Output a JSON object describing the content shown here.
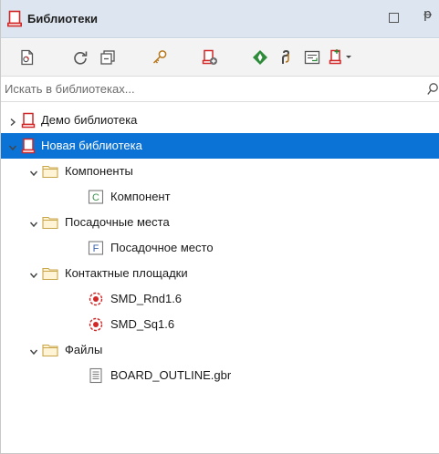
{
  "window": {
    "title": "Библиотеки"
  },
  "toolbar": {
    "buttons": [
      {
        "name": "open-library",
        "icon": "open-document-icon"
      },
      {
        "name": "refresh",
        "icon": "refresh-icon"
      },
      {
        "name": "collapse-all",
        "icon": "collapse-icon"
      },
      {
        "name": "key",
        "icon": "key-icon"
      },
      {
        "name": "add-library",
        "icon": "add-library-icon"
      },
      {
        "name": "navigate",
        "icon": "navigate-icon"
      },
      {
        "name": "link",
        "icon": "link-icon"
      },
      {
        "name": "properties",
        "icon": "properties-icon"
      },
      {
        "name": "library-menu",
        "icon": "library-dropdown-icon"
      }
    ]
  },
  "search": {
    "placeholder": "Искать в библиотеках..."
  },
  "tree": {
    "items": [
      {
        "label": "Демо библиотека",
        "level": 0,
        "expanded": false,
        "type": "library",
        "selected": false
      },
      {
        "label": "Новая библиотека",
        "level": 0,
        "expanded": true,
        "type": "library",
        "selected": true
      },
      {
        "label": "Компоненты",
        "level": 1,
        "expanded": true,
        "type": "folder",
        "selected": false
      },
      {
        "label": "Компонент",
        "level": 2,
        "type": "component",
        "badge": "C",
        "selected": false
      },
      {
        "label": "Посадочные места",
        "level": 1,
        "expanded": true,
        "type": "folder",
        "selected": false
      },
      {
        "label": "Посадочное место",
        "level": 2,
        "type": "footprint",
        "badge": "F",
        "selected": false
      },
      {
        "label": "Контактные площадки",
        "level": 1,
        "expanded": true,
        "type": "folder",
        "selected": false
      },
      {
        "label": "SMD_Rnd1.6",
        "level": 2,
        "type": "pad",
        "selected": false
      },
      {
        "label": "SMD_Sq1.6",
        "level": 2,
        "type": "pad",
        "selected": false
      },
      {
        "label": "Файлы",
        "level": 1,
        "expanded": true,
        "type": "folder",
        "selected": false
      },
      {
        "label": "BOARD_OUTLINE.gbr",
        "level": 2,
        "type": "file",
        "selected": false
      }
    ]
  },
  "colors": {
    "titlebar": "#dde6f0",
    "toolbar": "#f3f3f3",
    "selection": "#0b73d6",
    "library_red": "#d02828",
    "folder_fill": "#fff4d6",
    "folder_border": "#c9a64a",
    "navigate_green": "#2e8b3a"
  }
}
